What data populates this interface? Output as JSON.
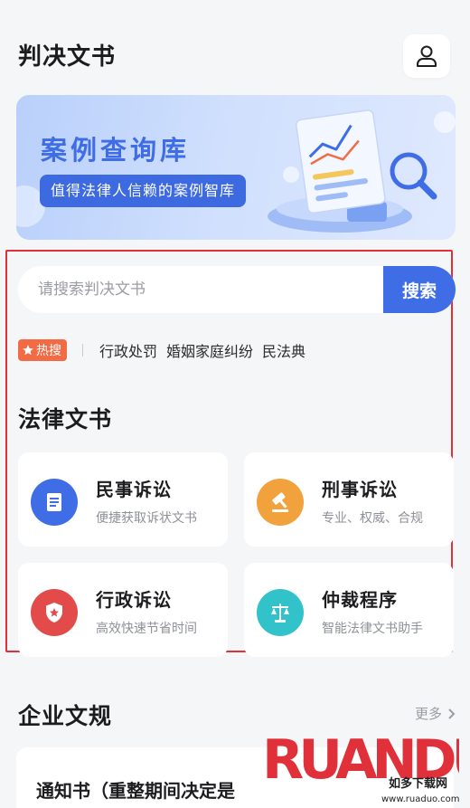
{
  "header": {
    "title": "判决文书",
    "user_icon": "user-icon"
  },
  "banner": {
    "title": "案例查询库",
    "subtitle": "值得法律人信赖的案例智库"
  },
  "search": {
    "placeholder": "请搜索判决文书",
    "button_label": "搜索"
  },
  "hot": {
    "badge": "热搜",
    "tags": [
      "行政处罚",
      "婚姻家庭纠纷",
      "民法典"
    ]
  },
  "legal_docs": {
    "title": "法律文书",
    "cards": [
      {
        "title": "民事诉讼",
        "subtitle": "便捷获取诉状文书",
        "icon": "document-icon",
        "color": "#3f6de6"
      },
      {
        "title": "刑事诉讼",
        "subtitle": "专业、权威、合规",
        "icon": "gavel-icon",
        "color": "#f2a23c"
      },
      {
        "title": "行政诉讼",
        "subtitle": "高效快速节省时间",
        "icon": "shield-star-icon",
        "color": "#e34a4a"
      },
      {
        "title": "仲裁程序",
        "subtitle": "智能法律文书助手",
        "icon": "scales-icon",
        "color": "#32c2c9"
      }
    ]
  },
  "enterprise": {
    "title": "企业文规",
    "more_label": "更多",
    "first_item": "通知书（重整期间决定是"
  },
  "watermark": {
    "main": "RUANDUO",
    "sub": "如多下载网",
    "url": "www.ruaduo.com"
  }
}
